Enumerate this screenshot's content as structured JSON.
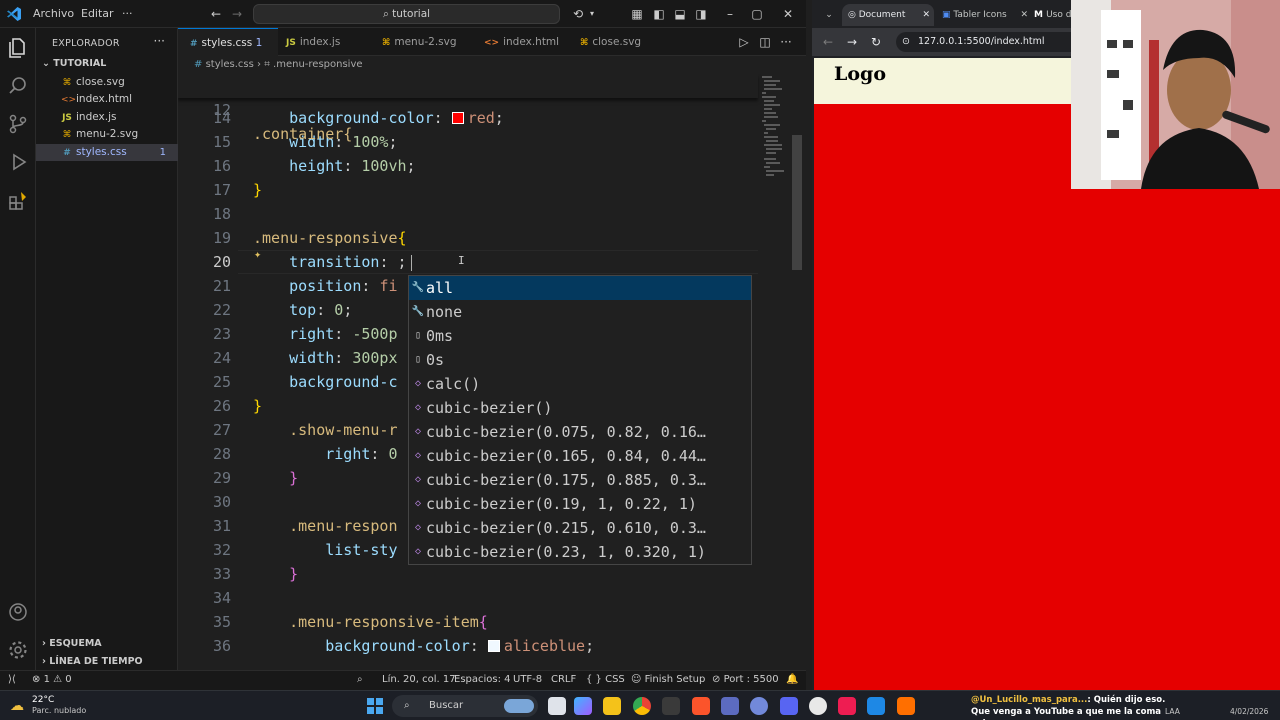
{
  "vscode": {
    "menu": [
      "Archivo",
      "Editar"
    ],
    "search": "tutorial",
    "explorer_title": "EXPLORADOR",
    "folder": "TUTORIAL",
    "files": [
      {
        "name": "close.svg",
        "icon": "svg"
      },
      {
        "name": "index.html",
        "icon": "html"
      },
      {
        "name": "index.js",
        "icon": "js"
      },
      {
        "name": "menu-2.svg",
        "icon": "svg"
      },
      {
        "name": "styles.css",
        "icon": "css",
        "badge": "1",
        "active": true
      }
    ],
    "sections": [
      "ESQUEMA",
      "LÍNEA DE TIEMPO"
    ],
    "tabs": [
      {
        "label": "styles.css",
        "badge": "1",
        "icon": "#",
        "active": true
      },
      {
        "label": "index.js",
        "icon": "JS"
      },
      {
        "label": "menu-2.svg",
        "icon": "⌘"
      },
      {
        "label": "index.html",
        "icon": "<>"
      },
      {
        "label": "close.svg",
        "icon": "⌘"
      }
    ],
    "breadcrumb": [
      "styles.css",
      ".menu-responsive"
    ],
    "sticky_header": ".container{",
    "code_lines": [
      {
        "n": "14",
        "parts": [
          [
            "",
            "    "
          ],
          [
            "prop",
            "background-color"
          ],
          [
            "",
            ": "
          ],
          [
            "swatch",
            "#ff0000"
          ],
          [
            "val",
            "red"
          ],
          [
            "",
            ";"
          ]
        ]
      },
      {
        "n": "15",
        "parts": [
          [
            "",
            "    "
          ],
          [
            "prop",
            "width"
          ],
          [
            "",
            ": "
          ],
          [
            "num",
            "100%"
          ],
          [
            "",
            ";"
          ]
        ]
      },
      {
        "n": "16",
        "parts": [
          [
            "",
            "    "
          ],
          [
            "prop",
            "height"
          ],
          [
            "",
            ": "
          ],
          [
            "num",
            "100vh"
          ],
          [
            "",
            ";"
          ]
        ]
      },
      {
        "n": "17",
        "parts": [
          [
            "br",
            "}"
          ]
        ]
      },
      {
        "n": "18",
        "parts": []
      },
      {
        "n": "19",
        "parts": [
          [
            "sel",
            ".menu-responsive"
          ],
          [
            "br",
            "{"
          ]
        ]
      },
      {
        "n": "20",
        "parts": [
          [
            "",
            "    "
          ],
          [
            "prop",
            "transition"
          ],
          [
            "",
            ": ;"
          ]
        ],
        "current": true
      },
      {
        "n": "21",
        "parts": [
          [
            "",
            "    "
          ],
          [
            "prop",
            "position"
          ],
          [
            "",
            ": "
          ],
          [
            "val",
            "fi"
          ]
        ]
      },
      {
        "n": "22",
        "parts": [
          [
            "",
            "    "
          ],
          [
            "prop",
            "top"
          ],
          [
            "",
            ": "
          ],
          [
            "num",
            "0"
          ],
          [
            "",
            ";"
          ]
        ]
      },
      {
        "n": "23",
        "parts": [
          [
            "",
            "    "
          ],
          [
            "prop",
            "right"
          ],
          [
            "",
            ": "
          ],
          [
            "num",
            "-500p"
          ]
        ]
      },
      {
        "n": "24",
        "parts": [
          [
            "",
            "    "
          ],
          [
            "prop",
            "width"
          ],
          [
            "",
            ": "
          ],
          [
            "num",
            "300px"
          ]
        ]
      },
      {
        "n": "25",
        "parts": [
          [
            "",
            "    "
          ],
          [
            "prop",
            "background-c"
          ]
        ]
      },
      {
        "n": "26",
        "parts": [
          [
            "br",
            "}"
          ]
        ]
      },
      {
        "n": "27",
        "parts": [
          [
            "",
            "    "
          ],
          [
            "sel",
            ".show-menu-r"
          ]
        ]
      },
      {
        "n": "28",
        "parts": [
          [
            "",
            "        "
          ],
          [
            "prop",
            "right"
          ],
          [
            "",
            ": "
          ],
          [
            "num",
            "0"
          ]
        ]
      },
      {
        "n": "29",
        "parts": [
          [
            "",
            "    "
          ],
          [
            "br2",
            "}"
          ]
        ]
      },
      {
        "n": "30",
        "parts": []
      },
      {
        "n": "31",
        "parts": [
          [
            "",
            "    "
          ],
          [
            "sel",
            ".menu-respon"
          ]
        ]
      },
      {
        "n": "32",
        "parts": [
          [
            "",
            "        "
          ],
          [
            "prop",
            "list-sty"
          ]
        ]
      },
      {
        "n": "33",
        "parts": [
          [
            "",
            "    "
          ],
          [
            "br2",
            "}"
          ]
        ]
      },
      {
        "n": "34",
        "parts": []
      },
      {
        "n": "35",
        "parts": [
          [
            "",
            "    "
          ],
          [
            "sel",
            ".menu-responsive-item"
          ],
          [
            "br2",
            "{"
          ]
        ]
      },
      {
        "n": "36",
        "parts": [
          [
            "",
            "        "
          ],
          [
            "prop",
            "background-color"
          ],
          [
            "",
            ": "
          ],
          [
            "swatch",
            "#f0f8ff"
          ],
          [
            "val",
            "aliceblue"
          ],
          [
            "",
            ";"
          ]
        ]
      }
    ],
    "suggestions": [
      {
        "label": "all",
        "icon": "🔧",
        "active": true
      },
      {
        "label": "none",
        "icon": "🔧"
      },
      {
        "label": "0ms",
        "icon": "▯"
      },
      {
        "label": "0s",
        "icon": "▯"
      },
      {
        "label": "calc()",
        "icon": "◇"
      },
      {
        "label": "cubic-bezier()",
        "icon": "◇"
      },
      {
        "label": "cubic-bezier(0.075, 0.82, 0.16…",
        "icon": "◇"
      },
      {
        "label": "cubic-bezier(0.165, 0.84, 0.44…",
        "icon": "◇"
      },
      {
        "label": "cubic-bezier(0.175, 0.885, 0.3…",
        "icon": "◇"
      },
      {
        "label": "cubic-bezier(0.19, 1, 0.22, 1)",
        "icon": "◇"
      },
      {
        "label": "cubic-bezier(0.215, 0.610, 0.3…",
        "icon": "◇"
      },
      {
        "label": "cubic-bezier(0.23, 1, 0.320, 1)",
        "icon": "◇"
      }
    ],
    "status": {
      "errors": "1",
      "warnings": "0",
      "position": "Lín. 20, col. 17",
      "spaces": "Espacios: 4",
      "encoding": "UTF-8",
      "eol": "CRLF",
      "language": "CSS",
      "finish_setup": "Finish Setup",
      "port": "Port : 5500"
    }
  },
  "browser": {
    "tabs": [
      "Document",
      "Tabler Icons",
      "Uso d"
    ],
    "url": "127.0.0.1:5500/index.html",
    "logo": "Logo",
    "page_color": "#e50000",
    "header_color": "#f5f5dc"
  },
  "taskbar": {
    "weather_temp": "22°C",
    "weather_desc": "Parc. nublado",
    "search": "Buscar",
    "chat_user": "@Un_Lucillo_mas_para...",
    "chat_text": ": Quién dijo eso. Que venga a YouTube a que me la coma x d",
    "lang": "LAA",
    "date": "4/02/2026"
  }
}
